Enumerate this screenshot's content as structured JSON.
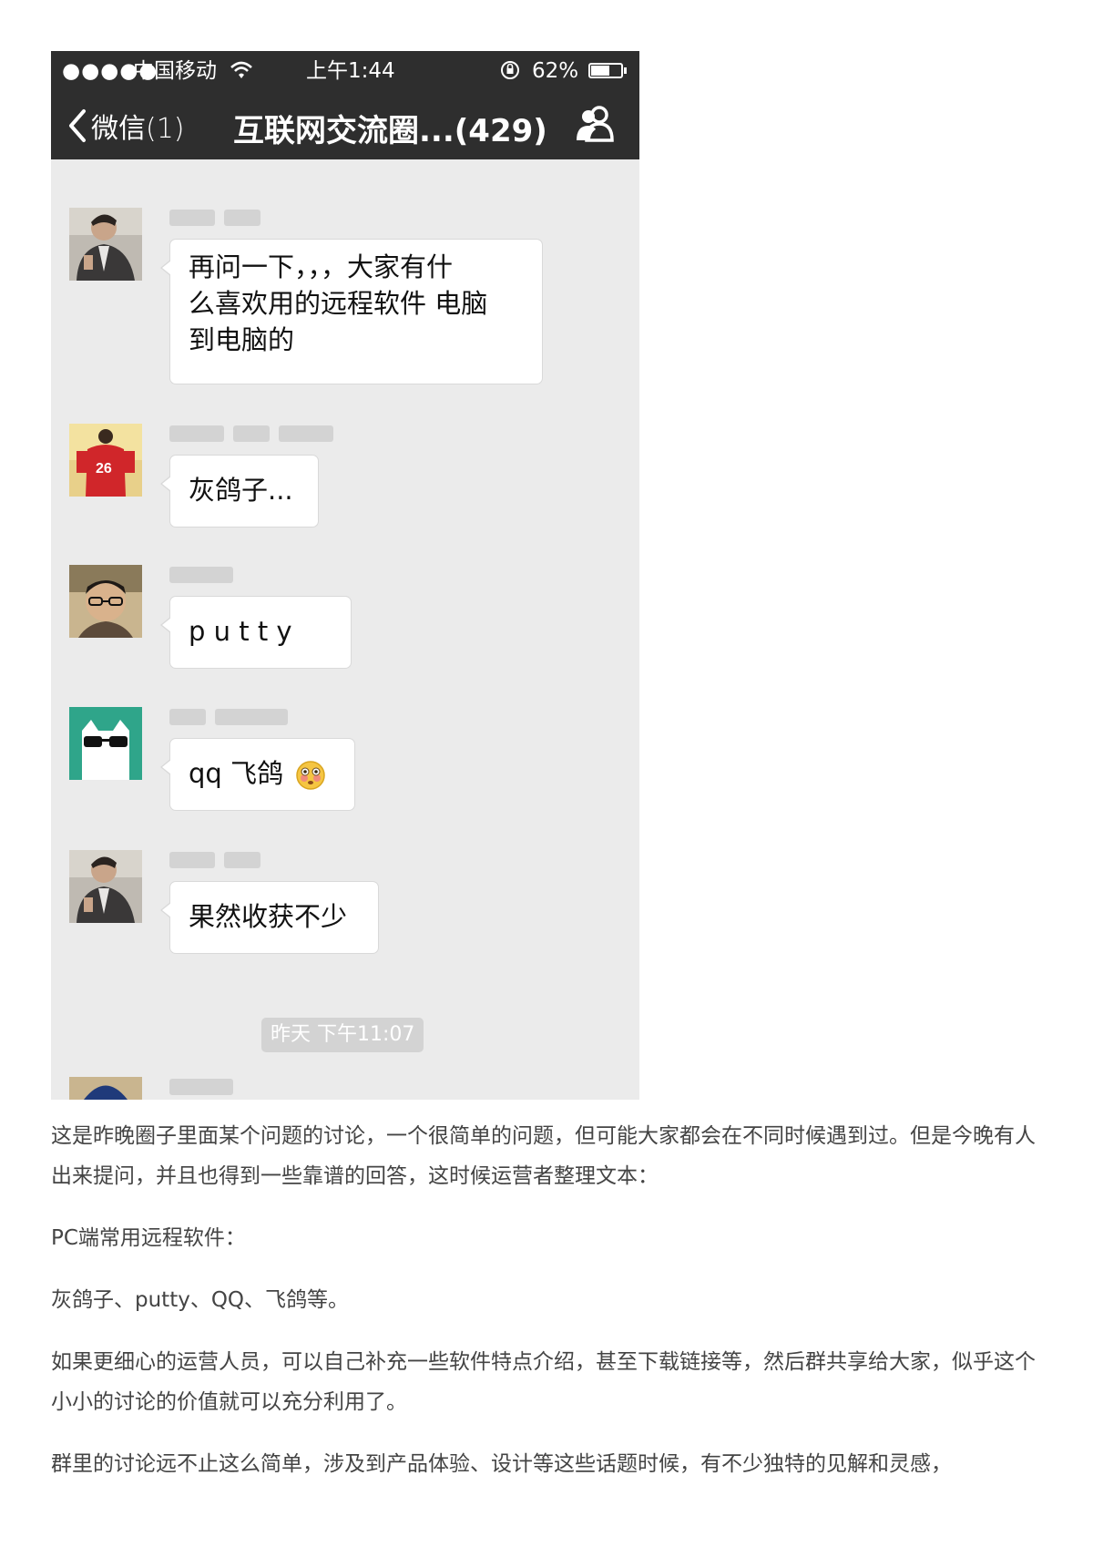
{
  "status_bar": {
    "signal": "●●●●●",
    "carrier": "中国移动",
    "time": "上午1:44",
    "battery": "62%",
    "battery_level": 0.62
  },
  "nav": {
    "back_label": "微信(1)",
    "title": "互联网交流圈...(429)"
  },
  "messages": [
    {
      "text_lines": [
        "再问一下，，，大家有什",
        "么喜欢用的远程软件 电脑",
        "到电脑的"
      ]
    },
    {
      "text": "灰鸽子..."
    },
    {
      "text": "p u t t y"
    },
    {
      "text": "qq  飞鸽"
    },
    {
      "text": "果然收获不少"
    }
  ],
  "timestamp": "昨天 下午11:07",
  "article": {
    "paragraphs": [
      "这是昨晚圈子里面某个问题的讨论，一个很简单的问题，但可能大家都会在不同时候遇到过。但是今晚有人出来提问，并且也得到一些靠谱的回答，这时候运营者整理文本：",
      "PC端常用远程软件：",
      "灰鸽子、putty、QQ、飞鸽等。",
      "如果更细心的运营人员，可以自己补充一些软件特点介绍，甚至下载链接等，然后群共享给大家，似乎这个小小的讨论的价值就可以充分利用了。",
      "群里的讨论远不止这么简单，涉及到产品体验、设计等这些话题时候，有不少独特的见解和灵感，"
    ]
  },
  "colors": {
    "bar_bg": "#2e2e2e",
    "chat_bg": "#ebebeb",
    "bubble_bg": "#ffffff",
    "article_text": "#444444"
  }
}
